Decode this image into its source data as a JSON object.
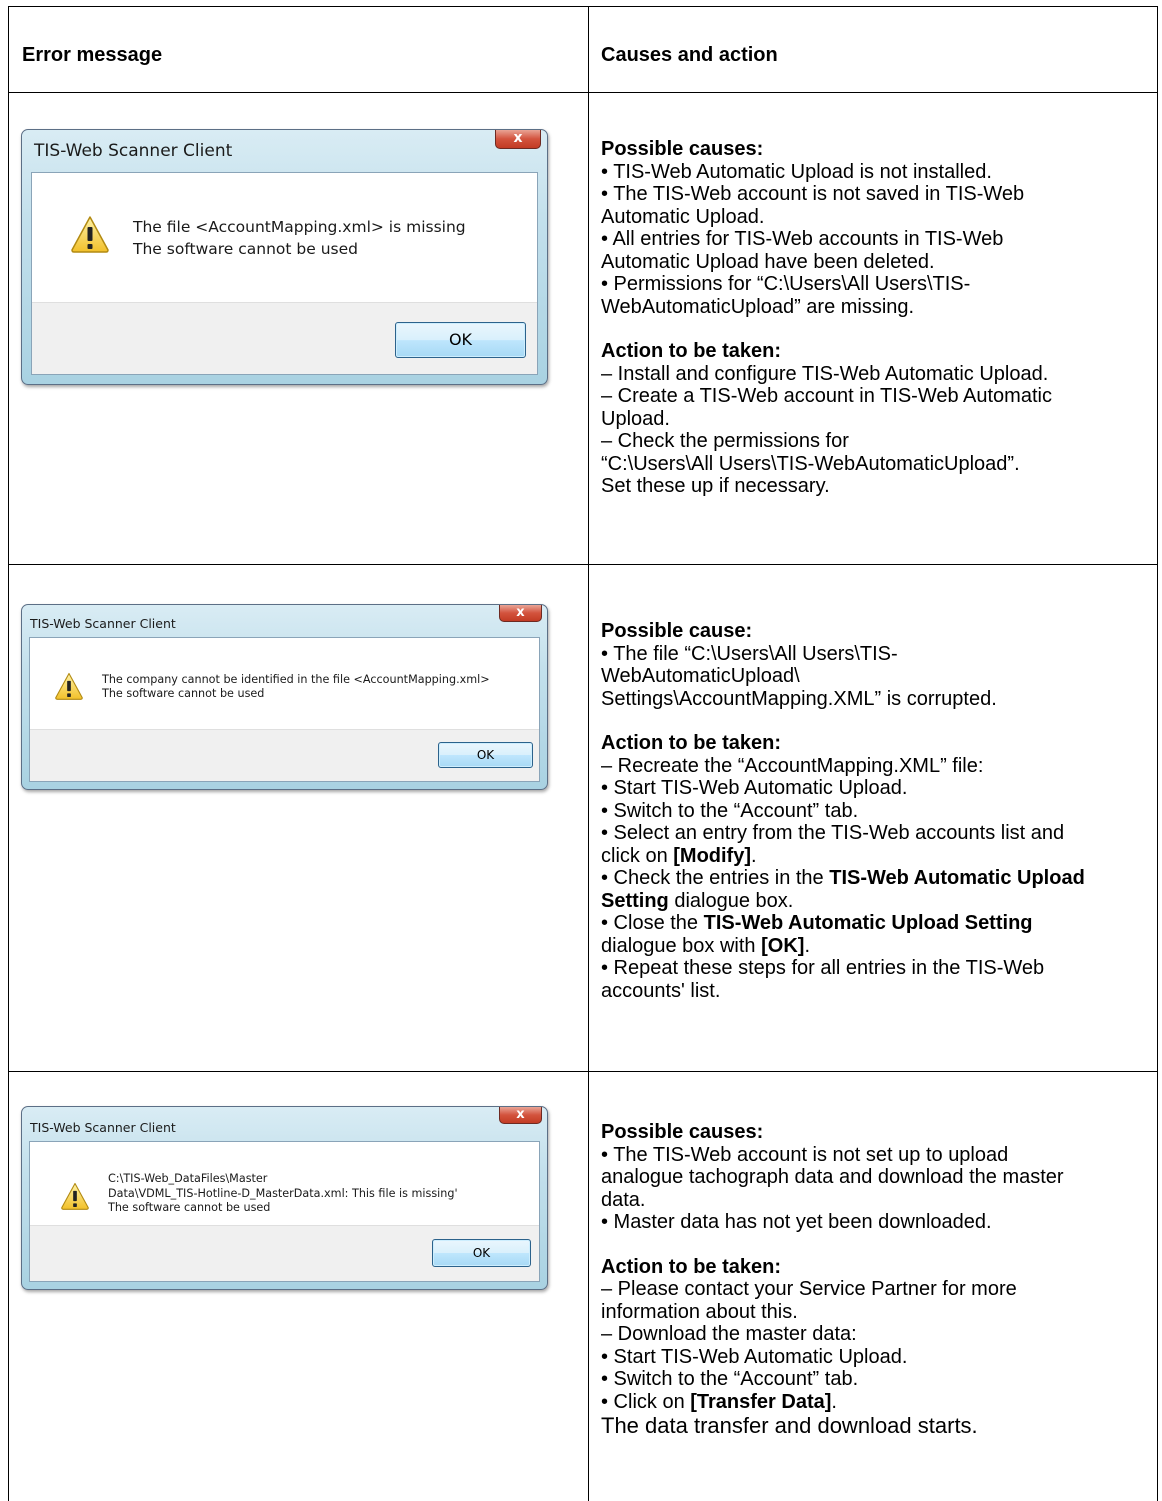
{
  "headers": {
    "col1": "Error message",
    "col2": "Causes and action"
  },
  "rows": [
    {
      "dialog": {
        "title": "TIS-Web Scanner Client",
        "close": "x",
        "message": [
          "The file <AccountMapping.xml> is missing",
          "The software cannot be used"
        ],
        "ok": "OK"
      },
      "causes_heading": "Possible causes:",
      "causes": [
        "• TIS-Web Automatic Upload is not installed.",
        "• The TIS-Web account is not saved in TIS-Web",
        "Automatic Upload.",
        "• All entries for TIS-Web accounts in TIS-Web",
        "Automatic Upload have been deleted.",
        "• Permissions for “C:\\Users\\All Users\\TIS-",
        "WebAutomaticUpload” are missing."
      ],
      "action_heading": "Action to be taken:",
      "actions": [
        "– Install and configure TIS-Web Automatic Upload.",
        "– Create a TIS-Web account in TIS-Web Automatic",
        "Upload.",
        "– Check the permissions for",
        "“C:\\Users\\All Users\\TIS-WebAutomaticUpload”.",
        "Set these up if necessary."
      ]
    },
    {
      "dialog": {
        "title": "TIS-Web Scanner Client",
        "close": "x",
        "message": [
          "The company cannot be identified in the file <AccountMapping.xml>",
          "The software cannot be used"
        ],
        "ok": "OK"
      },
      "causes_heading": "Possible cause:",
      "causes": [
        "• The file “C:\\Users\\All Users\\TIS-",
        "WebAutomaticUpload\\",
        "Settings\\AccountMapping.XML” is corrupted."
      ],
      "action_heading": "Action to be taken:",
      "actions": [
        "– Recreate the “AccountMapping.XML” file:",
        "• Start TIS-Web Automatic Upload.",
        "• Switch to the “Account” tab.",
        "• Select an entry from the TIS-Web accounts list and",
        "click on ",
        "[Modify]",
        ".",
        "• Check the entries in the ",
        "TIS-Web Automatic Upload",
        "Setting",
        " dialogue box.",
        "• Close the ",
        "TIS-Web Automatic Upload Setting",
        "dialogue box with ",
        "[OK]",
        ".",
        "• Repeat these steps for all entries in the TIS-Web",
        "accounts' list."
      ]
    },
    {
      "dialog": {
        "title": "TIS-Web Scanner Client",
        "close": "x",
        "message": [
          "C:\\TIS-Web_DataFiles\\Master",
          "Data\\VDML_TIS-Hotline-D_MasterData.xml: This file is missing'",
          "The software cannot be used"
        ],
        "ok": "OK"
      },
      "causes_heading": "Possible causes:",
      "causes": [
        "• The TIS-Web account is not set up to upload",
        "analogue tachograph data and download the master",
        "data.",
        "• Master data has not yet been downloaded."
      ],
      "action_heading": "Action to be taken:",
      "actions": [
        "– Please contact your Service Partner for more",
        "information about this.",
        "– Download the master data:",
        "• Start TIS-Web Automatic Upload.",
        "• Switch to the “Account” tab.",
        "• Click on ",
        "[Transfer Data]",
        ".",
        "The data transfer and download starts."
      ]
    }
  ]
}
